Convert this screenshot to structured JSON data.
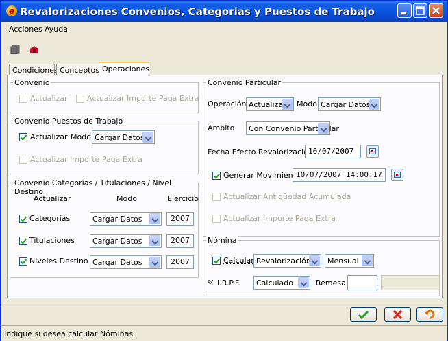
{
  "window": {
    "title": "Revalorizaciones Convenios, Categorias y Puestos de Trabajo",
    "app_icon": "e"
  },
  "menu": {
    "items": [
      "Acciones",
      "Ayuda"
    ]
  },
  "toolbar": {
    "icons": [
      "copy-icon",
      "exit-icon"
    ]
  },
  "tabs": [
    {
      "label": "Condiciones",
      "active": false
    },
    {
      "label": "Conceptos",
      "active": false
    },
    {
      "label": "Operaciones",
      "active": true
    }
  ],
  "convenio": {
    "legend": "Convenio",
    "actualizar_label": "Actualizar",
    "actualizar_checked": false,
    "paga_extra_label": "Actualizar Importe Paga Extra",
    "paga_extra_checked": false
  },
  "puestos": {
    "legend": "Convenio Puestos de Trabajo",
    "actualizar_label": "Actualizar",
    "actualizar_checked": true,
    "modo_label": "Modo",
    "modo_value": "Cargar Datos",
    "paga_extra_label": "Actualizar Importe Paga Extra",
    "paga_extra_checked": false
  },
  "categorias": {
    "legend": "Convenio Categorías / Titulaciones / Nivel Destino",
    "headers": {
      "actualizar": "Actualizar",
      "modo": "Modo",
      "ejercicio": "Ejercicio"
    },
    "rows": [
      {
        "label": "Categorías",
        "checked": true,
        "modo": "Cargar Datos",
        "ejercicio": "2007"
      },
      {
        "label": "Titulaciones",
        "checked": true,
        "modo": "Cargar Datos",
        "ejercicio": "2007"
      },
      {
        "label": "Niveles Destino",
        "checked": true,
        "modo": "Cargar Datos",
        "ejercicio": "2007"
      }
    ]
  },
  "particular": {
    "legend": "Convenio Particular",
    "operacion_label": "Operación",
    "operacion_value": "Actualizar",
    "modo_label": "Modo",
    "modo_value": "Cargar Datos",
    "ambito_label": "Ámbito",
    "ambito_value": "Con Convenio Particular",
    "fecha_label": "Fecha Efecto Revalorización",
    "fecha_value": "10/07/2007",
    "generar_label": "Generar Movimiento",
    "generar_checked": true,
    "generar_value": "10/07/2007 14:00:17",
    "antiguedad_label": "Actualizar Antigüedad Acumulada",
    "paga_extra_label": "Actualizar Importe Paga Extra"
  },
  "nomina": {
    "legend": "Nómina",
    "calcular_label": "Calcular",
    "calcular_checked": true,
    "tipo_value": "Revalorización",
    "periodo_value": "Mensual",
    "irpf_label": "% I.R.P.F.",
    "irpf_value": "Calculado",
    "remesa_label": "Remesa",
    "remesa_value": "",
    "remesa_desc": ""
  },
  "actions": {
    "icons": [
      "accept-check-icon",
      "cancel-x-icon",
      "undo-icon"
    ]
  },
  "status": {
    "text": "Indique si desea calcular Nóminas."
  },
  "colors": {
    "title_bar": "#0a55e0",
    "accent_tab": "#ffc83c",
    "check_green": "#21a121",
    "cancel_red": "#d42a1c"
  }
}
